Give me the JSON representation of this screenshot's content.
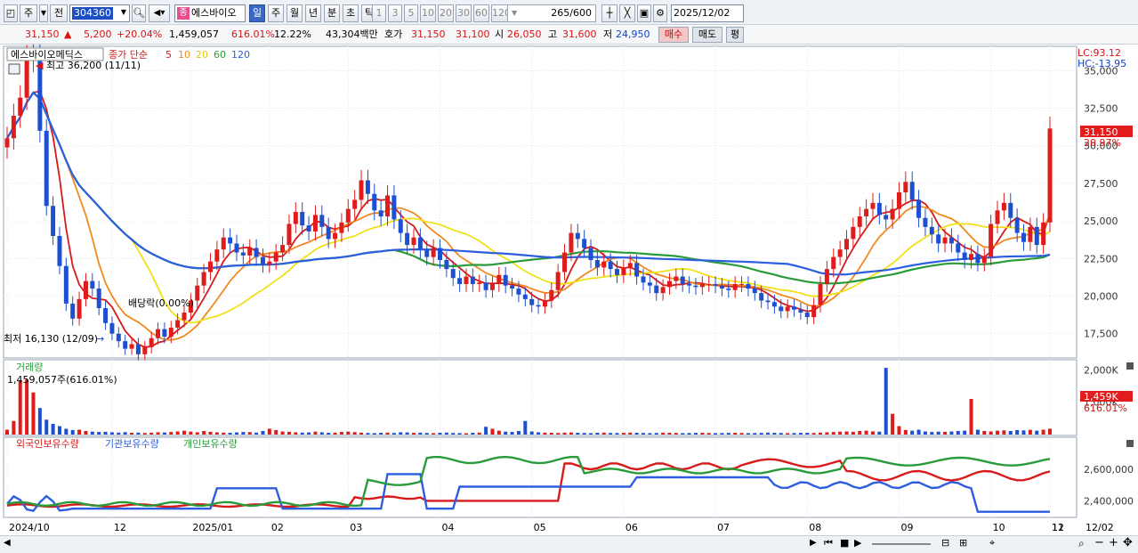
{
  "toolbar": {
    "period_main": "주",
    "period_prev": "전",
    "code": "304360",
    "stock_name": "에스바이오",
    "name_tag": "종",
    "periods": [
      {
        "label": "일",
        "selected": true
      },
      {
        "label": "주",
        "selected": false
      },
      {
        "label": "월",
        "selected": false
      },
      {
        "label": "년",
        "selected": false
      },
      {
        "label": "분",
        "selected": false
      },
      {
        "label": "초",
        "selected": false
      },
      {
        "label": "틱",
        "selected": false
      }
    ],
    "intervals": [
      "1",
      "3",
      "5",
      "10",
      "20",
      "30",
      "60",
      "120"
    ],
    "count": "265",
    "count_total": "/600",
    "date": "2025/12/02"
  },
  "info": {
    "price": "31,150",
    "arrow": "▲",
    "change": "5,200",
    "change_pct": "+20.04%",
    "volume": "1,459,057",
    "volume_pct": "616.01%",
    "turnover": "12.22%",
    "amount": "43,304백만",
    "quote_label": "호가",
    "ask": "31,150",
    "bid": "31,100",
    "open_label": "시",
    "open": "26,050",
    "high_label": "고",
    "high": "31,600",
    "low_label": "저",
    "low": "24,950",
    "buy": "매수",
    "sell": "매도",
    "eval": "평"
  },
  "price_panel": {
    "stock_label": "에스바이오메딕스",
    "indicator_label": "종가 단순",
    "ma_periods": [
      "5",
      "10",
      "20",
      "60",
      "120"
    ],
    "ma_colors": [
      "#d81a1a",
      "#f08a20",
      "#f2e018",
      "#2a9b3a",
      "#2e5ee0"
    ],
    "high_note": "최고 36,200 (11/11)",
    "low_note": "최저 16,130 (12/09)",
    "dividend_note": "배당락(0.00%)",
    "lc": "LC:93.12",
    "hc": "HC:-13.95",
    "y_ticks": [
      "35,000",
      "32,500",
      "30,000",
      "27,500",
      "25,000",
      "22,500",
      "20,000",
      "17,500"
    ],
    "current_price_tag": "31,150",
    "current_pct_tag": "20.97%"
  },
  "volume_panel": {
    "title": "거래량",
    "value_text": "1,459,057주(616.01%)",
    "y_ticks": [
      "2,000K",
      "1,000K"
    ],
    "current_tag": "1,459K",
    "current_pct": "616.01%"
  },
  "holdings_panel": {
    "legends": [
      "외국인보유수량",
      "기관보유수량",
      "개인보유수량"
    ],
    "colors": [
      "#d81a1a",
      "#2e5ee0",
      "#2a9b3a"
    ],
    "y_ticks": [
      "2,600,000",
      "2,400,000"
    ]
  },
  "x_axis": [
    "2024/10",
    "12",
    "2025/01",
    "02",
    "03",
    "04",
    "05",
    "06",
    "07",
    "08",
    "09",
    "10",
    "11",
    "12",
    "12/02"
  ],
  "chart_data": {
    "type": "candlestick",
    "ma_periods": [
      5,
      10,
      20,
      60,
      120
    ],
    "y_range": [
      16000,
      36500
    ],
    "months": [
      "2024/10",
      "12",
      "2025/01",
      "02",
      "03",
      "04",
      "05",
      "06",
      "07",
      "08",
      "09",
      "10",
      "11",
      "12"
    ],
    "close_series": [
      30500,
      32000,
      33200,
      35800,
      36200,
      31000,
      26000,
      24000,
      22000,
      19500,
      18500,
      19800,
      21000,
      20500,
      19200,
      18200,
      17500,
      17000,
      16500,
      16800,
      16130,
      16600,
      17200,
      17800,
      17300,
      17900,
      18400,
      18900,
      19700,
      20700,
      21600,
      22300,
      23100,
      23900,
      23500,
      22900,
      22700,
      23200,
      22600,
      22100,
      22300,
      22900,
      23400,
      24800,
      25600,
      24700,
      24300,
      25400,
      24600,
      23800,
      24200,
      24900,
      25800,
      26400,
      27700,
      26800,
      25700,
      25300,
      26700,
      25100,
      24200,
      23400,
      23900,
      23100,
      22600,
      23200,
      22400,
      21800,
      21200,
      20800,
      21300,
      20800,
      20900,
      20400,
      20800,
      21400,
      20700,
      20500,
      20100,
      19800,
      19400,
      19300,
      19700,
      20400,
      21600,
      22900,
      24200,
      23800,
      23200,
      22400,
      21900,
      22300,
      21800,
      21400,
      21900,
      22200,
      21300,
      20900,
      20700,
      20200,
      20600,
      21000,
      21300,
      20800,
      20700,
      20600,
      20800,
      20800,
      20700,
      20500,
      20400,
      20800,
      20800,
      20500,
      20200,
      19700,
      19600,
      19300,
      19000,
      19300,
      19100,
      18900,
      18600,
      19400,
      20800,
      21800,
      22600,
      23100,
      23800,
      24600,
      25300,
      25800,
      26200,
      25400,
      25100,
      25800,
      26900,
      27600,
      26400,
      25200,
      24600,
      24100,
      23500,
      23900,
      23500,
      22900,
      22400,
      22800,
      22200,
      22600,
      24800,
      25700,
      26200,
      25200,
      24200,
      23600,
      24600,
      23400,
      24900,
      31150
    ],
    "volume_K": [
      150,
      420,
      1650,
      1700,
      1300,
      820,
      460,
      330,
      260,
      180,
      140,
      150,
      110,
      90,
      80,
      85,
      70,
      60,
      75,
      55,
      60,
      50,
      58,
      70,
      65,
      80,
      95,
      120,
      90,
      70,
      110,
      85,
      70,
      60,
      55,
      65,
      80,
      75,
      60,
      110,
      180,
      140,
      95,
      85,
      70,
      60,
      65,
      90,
      70,
      55,
      60,
      80,
      90,
      75,
      60,
      50,
      45,
      55,
      60,
      50,
      70,
      65,
      55,
      60,
      50,
      45,
      55,
      60,
      50,
      45,
      40,
      55,
      60,
      240,
      180,
      120,
      90,
      80,
      110,
      420,
      95,
      70,
      60,
      55,
      50,
      60,
      65,
      55,
      50,
      45,
      55,
      60,
      50,
      48,
      52,
      60,
      55,
      50,
      45,
      50,
      58,
      55,
      50,
      45,
      48,
      52,
      55,
      50,
      45,
      48,
      52,
      55,
      50,
      45,
      48,
      52,
      60,
      55,
      50,
      45,
      48,
      52,
      55,
      50,
      60,
      70,
      80,
      90,
      95,
      85,
      110,
      120,
      100,
      90,
      2060,
      640,
      260,
      140,
      120,
      150,
      95,
      80,
      90,
      85,
      95,
      110,
      120,
      1100,
      150,
      110,
      95,
      120,
      130,
      110,
      140,
      130,
      145,
      120,
      150,
      180,
      150,
      120,
      150,
      160,
      1459
    ]
  }
}
